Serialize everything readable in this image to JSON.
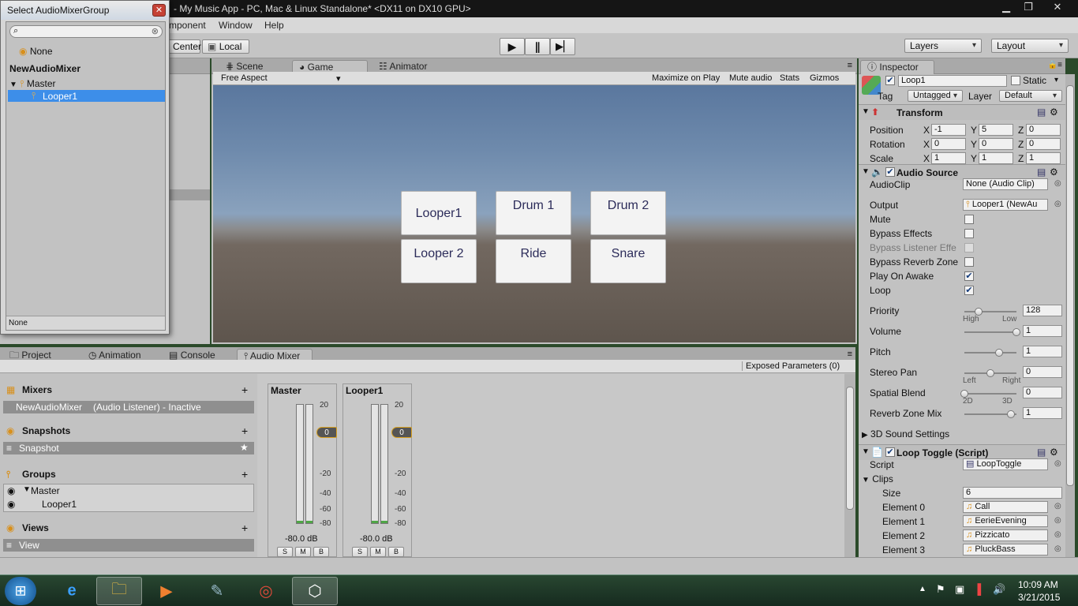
{
  "window": {
    "title": "- My Music App - PC, Mac & Linux Standalone* <DX11 on DX10 GPU>"
  },
  "menu": [
    "mponent",
    "Window",
    "Help"
  ],
  "toolbar": {
    "pivot_label": "Center",
    "space_label": "Local",
    "layers_label": "Layers",
    "layout_label": "Layout"
  },
  "scene_tabs": [
    {
      "label": "Scene",
      "icon": "grid-icon"
    },
    {
      "label": "Game",
      "icon": "pacman-icon"
    },
    {
      "label": "Animator",
      "icon": "nodes-icon"
    }
  ],
  "game_toolbar": {
    "aspect": "Free Aspect",
    "maximize": "Maximize on Play",
    "mute": "Mute audio",
    "stats": "Stats",
    "gizmos": "Gizmos"
  },
  "game_buttons": [
    "Looper1",
    "Drum 1",
    "Drum 2",
    "Looper 2",
    "Ride",
    "Snare"
  ],
  "inspector": {
    "tab": "Inspector",
    "object_name": "Loop1",
    "static_label": "Static",
    "tag_label": "Tag",
    "tag_value": "Untagged",
    "layer_label": "Layer",
    "layer_value": "Default",
    "transform": {
      "title": "Transform",
      "rows": [
        {
          "label": "Position",
          "x": "-1",
          "y": "5",
          "z": "0"
        },
        {
          "label": "Rotation",
          "x": "0",
          "y": "0",
          "z": "0"
        },
        {
          "label": "Scale",
          "x": "1",
          "y": "1",
          "z": "1"
        }
      ],
      "axis_x": "X",
      "axis_y": "Y",
      "axis_z": "Z"
    },
    "audio_source": {
      "title": "Audio Source",
      "audioclip_label": "AudioClip",
      "audioclip_value": "None (Audio Clip)",
      "output_label": "Output",
      "output_value": "Looper1 (NewAu",
      "mute_label": "Mute",
      "bypass_effects_label": "Bypass Effects",
      "bypass_listener_label": "Bypass Listener Effe",
      "bypass_reverb_label": "Bypass Reverb Zone",
      "play_on_awake_label": "Play On Awake",
      "loop_label": "Loop",
      "priority_label": "Priority",
      "priority_value": "128",
      "priority_low_hint": "High",
      "priority_high_hint": "Low",
      "priority_level": 0.28,
      "volume_label": "Volume",
      "volume_value": "1",
      "volume_level": 1.0,
      "pitch_label": "Pitch",
      "pitch_value": "1",
      "pitch_level": 0.66,
      "stereo_label": "Stereo Pan",
      "stereo_value": "0",
      "stereo_left": "Left",
      "stereo_right": "Right",
      "stereo_level": 0.5,
      "spatial_label": "Spatial Blend",
      "spatial_value": "0",
      "spatial_2d": "2D",
      "spatial_3d": "3D",
      "spatial_level": 0.0,
      "reverb_mix_label": "Reverb Zone Mix",
      "reverb_mix_value": "1",
      "reverb_mix_level": 0.9,
      "sound_settings_label": "3D Sound Settings"
    },
    "loop_toggle": {
      "title": "Loop Toggle (Script)",
      "script_label": "Script",
      "script_value": "LoopToggle",
      "clips_label": "Clips",
      "size_label": "Size",
      "size_value": "6",
      "elements": [
        {
          "label": "Element 0",
          "value": "Call"
        },
        {
          "label": "Element 1",
          "value": "EerieEvening"
        },
        {
          "label": "Element 2",
          "value": "Pizzicato"
        },
        {
          "label": "Element 3",
          "value": "PluckBass"
        }
      ]
    }
  },
  "bottom_tabs": [
    {
      "label": "Project",
      "icon": "folder-icon"
    },
    {
      "label": "Animation",
      "icon": "clock-icon"
    },
    {
      "label": "Console",
      "icon": "console-icon"
    },
    {
      "label": "Audio Mixer",
      "icon": "mixer-icon"
    }
  ],
  "mixer": {
    "exposed_params": "Exposed Parameters (0)",
    "mixers_title": "Mixers",
    "mixer_item": "NewAudioMixer",
    "mixer_item_state": "(Audio Listener) - Inactive",
    "snapshots_title": "Snapshots",
    "snapshot_item": "Snapshot",
    "groups_title": "Groups",
    "group_master": "Master",
    "group_looper": "Looper1",
    "views_title": "Views",
    "view_item": "View",
    "add_symbol": "+",
    "strips": [
      {
        "name": "Master",
        "db": "-80.0 dB",
        "attenuation": "0"
      },
      {
        "name": "Looper1",
        "db": "-80.0 dB",
        "attenuation": "0"
      }
    ],
    "scale_marks": [
      "20",
      "0",
      "-20",
      "-40",
      "-60",
      "-80"
    ],
    "strip_buttons": [
      "S",
      "M",
      "B"
    ]
  },
  "popup": {
    "title": "Select AudioMixerGroup",
    "none_item": "None",
    "mixer_name": "NewAudioMixer",
    "master": "Master",
    "looper": "Looper1",
    "footer": "None"
  },
  "taskbar": {
    "time": "10:09 AM",
    "date": "3/21/2015"
  }
}
